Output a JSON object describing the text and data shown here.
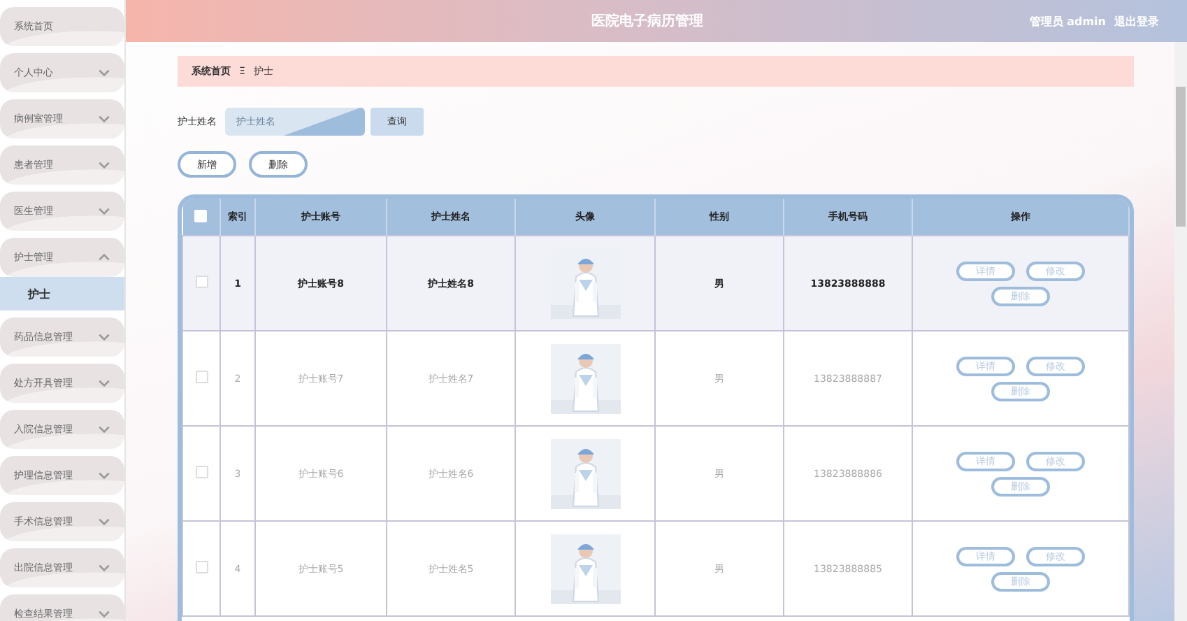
{
  "sidebar": {
    "items": [
      {
        "label": "系统首页"
      },
      {
        "label": "个人中心",
        "expanded": false
      },
      {
        "label": "病例室管理",
        "expanded": false
      },
      {
        "label": "患者管理",
        "expanded": false
      },
      {
        "label": "医生管理",
        "expanded": false
      },
      {
        "label": "护士管理",
        "expanded": true,
        "children": [
          {
            "label": "护士",
            "selected": true
          }
        ]
      },
      {
        "label": "药品信息管理",
        "expanded": false
      },
      {
        "label": "处方开具管理",
        "expanded": false
      },
      {
        "label": "入院信息管理",
        "expanded": false
      },
      {
        "label": "护理信息管理",
        "expanded": false
      },
      {
        "label": "手术信息管理",
        "expanded": false
      },
      {
        "label": "出院信息管理",
        "expanded": false
      },
      {
        "label": "检查结果管理",
        "expanded": false
      }
    ]
  },
  "header": {
    "title": "医院电子病历管理",
    "user": "管理员 admin",
    "logout": "退出登录"
  },
  "breadcrumb": {
    "items": [
      "系统首页",
      "护士"
    ],
    "separator": "Ξ"
  },
  "search": {
    "label": "护士姓名",
    "placeholder": "护士姓名",
    "button": "查询"
  },
  "actions": [
    "新增",
    "删除"
  ],
  "table": {
    "select_all": {
      "checked": false
    },
    "columns": [
      "索引",
      "护士账号",
      "护士姓名",
      "头像",
      "性别",
      "手机号码",
      "操作"
    ],
    "rows": [
      {
        "index": "1",
        "account": "护士账号8",
        "name": "护士姓名8",
        "avatar": {
          "kind": "picture"
        },
        "gender": "男",
        "phone": "13823888888",
        "highlighted": true,
        "checked": false,
        "buttons": [
          "详情",
          "修改",
          "删除"
        ]
      },
      {
        "index": "2",
        "account": "护士账号7",
        "name": "护士姓名7",
        "avatar": {
          "kind": "picture"
        },
        "gender": "男",
        "phone": "13823888887",
        "highlighted": false,
        "checked": false,
        "buttons": [
          "详情",
          "修改",
          "删除"
        ]
      },
      {
        "index": "3",
        "account": "护士账号6",
        "name": "护士姓名6",
        "avatar": {
          "kind": "picture"
        },
        "gender": "男",
        "phone": "13823888886",
        "highlighted": false,
        "checked": false,
        "buttons": [
          "详情",
          "修改",
          "删除"
        ]
      },
      {
        "index": "4",
        "account": "护士账号5",
        "name": "护士姓名5",
        "avatar": {
          "kind": "picture"
        },
        "gender": "男",
        "phone": "13823888885",
        "highlighted": false,
        "checked": false,
        "buttons": [
          "详情",
          "修改",
          "删除"
        ]
      }
    ]
  }
}
